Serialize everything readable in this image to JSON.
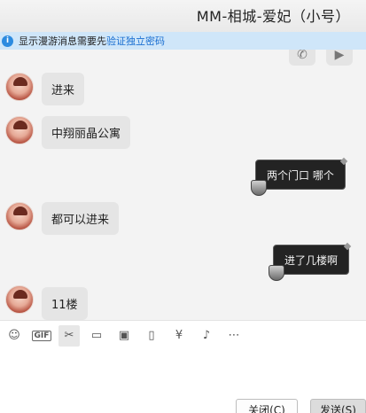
{
  "window": {
    "title": "MM-相城-爱妃（小号）"
  },
  "notice": {
    "text": "显示漫游消息需要先",
    "link": "验证独立密码",
    "icon": "info-icon"
  },
  "messages": [
    {
      "direction": "in",
      "text": "进来"
    },
    {
      "direction": "in",
      "text": "中翔丽晶公寓"
    },
    {
      "direction": "out",
      "text": "两个门口  哪个"
    },
    {
      "direction": "in",
      "text": "都可以进来"
    },
    {
      "direction": "out",
      "text": "进了几楼啊"
    },
    {
      "direction": "in",
      "text": "11楼"
    }
  ],
  "toolbar": {
    "items": [
      {
        "icon": "emoji-icon",
        "glyph": "☺"
      },
      {
        "icon": "gif-icon",
        "glyph": "GIF"
      },
      {
        "icon": "scissors-icon",
        "glyph": "✂"
      },
      {
        "icon": "folder-icon",
        "glyph": "▭"
      },
      {
        "icon": "image-icon",
        "glyph": "▣"
      },
      {
        "icon": "shake-icon",
        "glyph": "▯"
      },
      {
        "icon": "red-packet-icon",
        "glyph": "¥"
      },
      {
        "icon": "music-icon",
        "glyph": "♪"
      },
      {
        "icon": "more-icon",
        "glyph": "⋯"
      }
    ]
  },
  "buttons": {
    "close": "关闭(C)",
    "send": "发送(S)"
  },
  "colors": {
    "notice_bg": "#cfe6f9",
    "link": "#1a6fd1",
    "outgoing_bubble": "#232323",
    "incoming_bubble": "#e5e5e5"
  }
}
